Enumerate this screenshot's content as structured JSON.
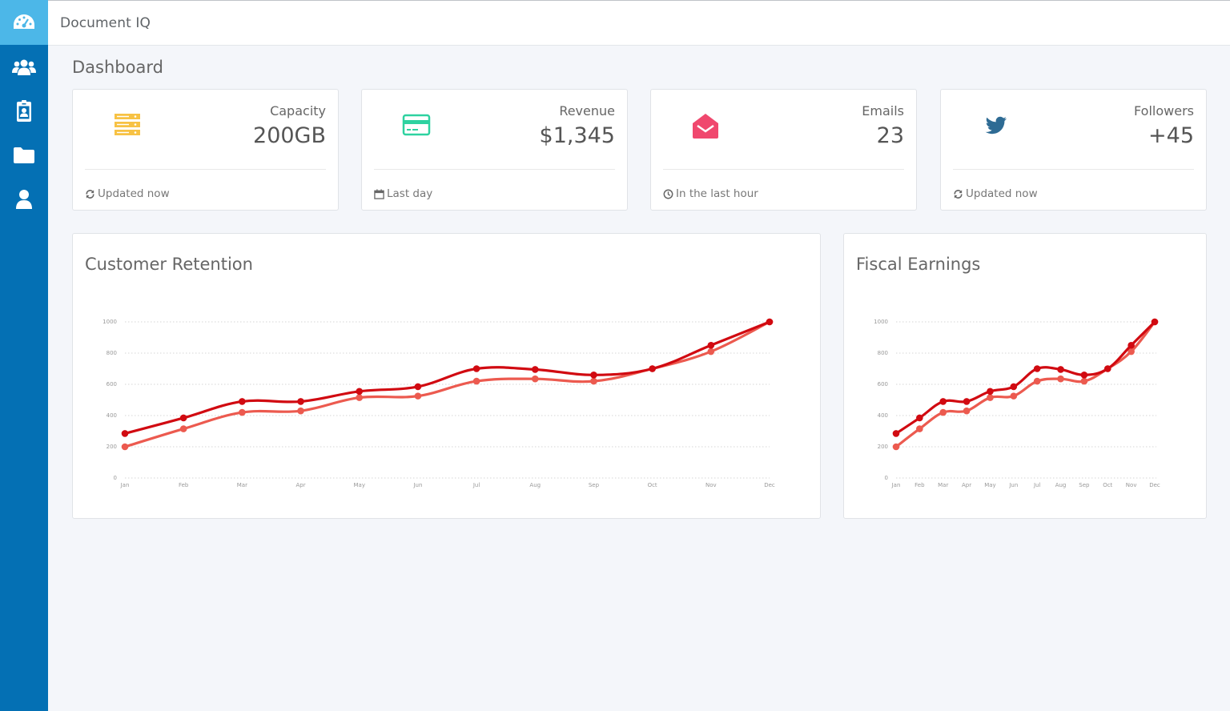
{
  "app": {
    "title": "Document IQ"
  },
  "page": {
    "title": "Dashboard"
  },
  "sidebar": {
    "items": [
      {
        "icon": "dashboard-icon",
        "active": true
      },
      {
        "icon": "users-icon",
        "active": false
      },
      {
        "icon": "id-badge-icon",
        "active": false
      },
      {
        "icon": "folder-icon",
        "active": false
      },
      {
        "icon": "user-icon",
        "active": false
      }
    ]
  },
  "stats": [
    {
      "label": "Capacity",
      "value": "200GB",
      "footer": "Updated now",
      "icon": "server-icon",
      "footer_icon": "refresh-icon",
      "color": "#f7c244"
    },
    {
      "label": "Revenue",
      "value": "$1,345",
      "footer": "Last day",
      "icon": "credit-card-icon",
      "footer_icon": "calendar-icon",
      "color": "#2ed2a0"
    },
    {
      "label": "Emails",
      "value": "23",
      "footer": "In the last hour",
      "icon": "envelope-open-icon",
      "footer_icon": "clock-icon",
      "color": "#f0486e"
    },
    {
      "label": "Followers",
      "value": "+45",
      "footer": "Updated now",
      "icon": "twitter-icon",
      "footer_icon": "refresh-icon",
      "color": "#2e6b94"
    }
  ],
  "colors": {
    "sidebar": "#0470b4",
    "sidebar_active": "#4cb7e8",
    "series_dark": "#d10a11",
    "series_light": "#ec5a4f"
  },
  "chart_data": [
    {
      "type": "line",
      "title": "Customer Retention",
      "categories": [
        "Jan",
        "Feb",
        "Mar",
        "Apr",
        "May",
        "Jun",
        "Jul",
        "Aug",
        "Sep",
        "Oct",
        "Nov",
        "Dec"
      ],
      "yticks": [
        0,
        200,
        400,
        600,
        800,
        1000
      ],
      "ylim": [
        0,
        1000
      ],
      "grid": true,
      "series": [
        {
          "values": [
            285,
            385,
            490,
            490,
            555,
            585,
            700,
            695,
            660,
            700,
            850,
            1000
          ],
          "color": "#d10a11"
        },
        {
          "values": [
            200,
            315,
            420,
            430,
            515,
            525,
            620,
            635,
            620,
            700,
            810,
            1000
          ],
          "color": "#ec5a4f"
        }
      ]
    },
    {
      "type": "line",
      "title": "Fiscal Earnings",
      "categories": [
        "Jan",
        "Feb",
        "Mar",
        "Apr",
        "May",
        "Jun",
        "Jul",
        "Aug",
        "Sep",
        "Oct",
        "Nov",
        "Dec"
      ],
      "yticks": [
        0,
        200,
        400,
        600,
        800,
        1000
      ],
      "ylim": [
        0,
        1000
      ],
      "grid": true,
      "series": [
        {
          "values": [
            285,
            385,
            490,
            490,
            555,
            585,
            700,
            695,
            660,
            700,
            850,
            1000
          ],
          "color": "#d10a11"
        },
        {
          "values": [
            200,
            315,
            420,
            430,
            515,
            525,
            620,
            635,
            620,
            700,
            810,
            1000
          ],
          "color": "#ec5a4f"
        }
      ]
    }
  ]
}
